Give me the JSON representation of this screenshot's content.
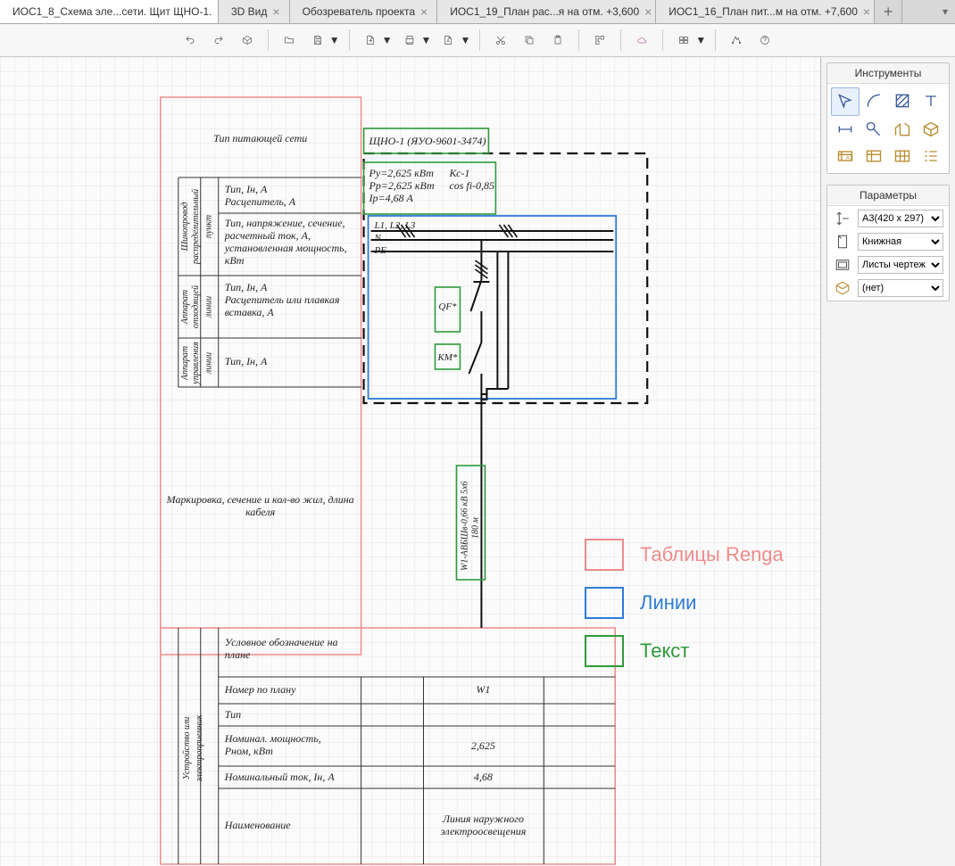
{
  "tabs": {
    "items": [
      {
        "label": "ИОС1_8_Схема эле...сети. Щит ЩНО-1.",
        "active": true
      },
      {
        "label": "3D Вид",
        "active": false
      },
      {
        "label": "Обозреватель проекта",
        "active": false
      },
      {
        "label": "ИОС1_19_План рас...я на отм. +3,600",
        "active": false
      },
      {
        "label": "ИОС1_16_План пит...м на отм. +7,600",
        "active": false
      }
    ]
  },
  "right": {
    "tools_title": "Инструменты",
    "params_title": "Параметры",
    "params": {
      "sheet_size": "A3(420 x 297)",
      "orientation": "Книжная",
      "sheet_category": "Листы чертеж",
      "level": "(нет)"
    }
  },
  "legend": {
    "tables": {
      "label": "Таблицы Renga",
      "color": "#ef8b8b"
    },
    "lines": {
      "label": "Линии",
      "color": "#2e7bd6"
    },
    "text": {
      "label": "Текст",
      "color": "#2f9a3a"
    }
  },
  "diagram": {
    "headers": {
      "feed_net": "Тип питающей сети",
      "busbar": {
        "side": "Шинопровод\nраспределительный\nпункт",
        "l1": "Тип, Iн, А",
        "l2": "Расцепитель, А",
        "l3": "Тип, напряжение, сечение,",
        "l4": "расчетный ток, А,",
        "l5": "установленная мощность,",
        "l6": "кВт"
      },
      "outgoing": {
        "side": "Аппарат\nотходящей\nлинии",
        "l1": "Тип, Iн, А",
        "l2": "Расцепитель или плавкая",
        "l3": "вставка, А"
      },
      "control": {
        "side": "Аппарат\nуправления\nлинии",
        "l1": "Тип, Iн, А"
      },
      "cable": "Маркировка, сечение и кол-во жил, длина\nкабеля",
      "device_side": "Устройство или\nэлектроприемник",
      "rows": {
        "symbol": "Условное обозначение на\nплане",
        "plan_no": "Номер по плану",
        "type": "Тип",
        "power": "Номинал. мощность,\nРном, кВт",
        "current": "Номинальный ток, Iн, А",
        "name": "Наименование"
      }
    },
    "panel_label": "ЩНО-1 (ЯУО-9601-3474)",
    "panel_calc": {
      "l1": "Ру=2,625 кВт",
      "l2": "Рр=2,625 кВт",
      "l3": "Iр=4,68 А",
      "r1": "Кс-1",
      "r2": "cos fi-0,85"
    },
    "phases": {
      "l1": "L1, L2, L3",
      "n": "N",
      "pe": "PE"
    },
    "qf": "QF*",
    "km": "KM*",
    "cable_label": "W1-АВБШв-0,66 кВ 5х6\n180 м",
    "values": {
      "plan_no": "W1",
      "type": "",
      "power": "2,625",
      "current": "4,68",
      "name": "Линия наружного\nэлектроосвещения"
    }
  }
}
